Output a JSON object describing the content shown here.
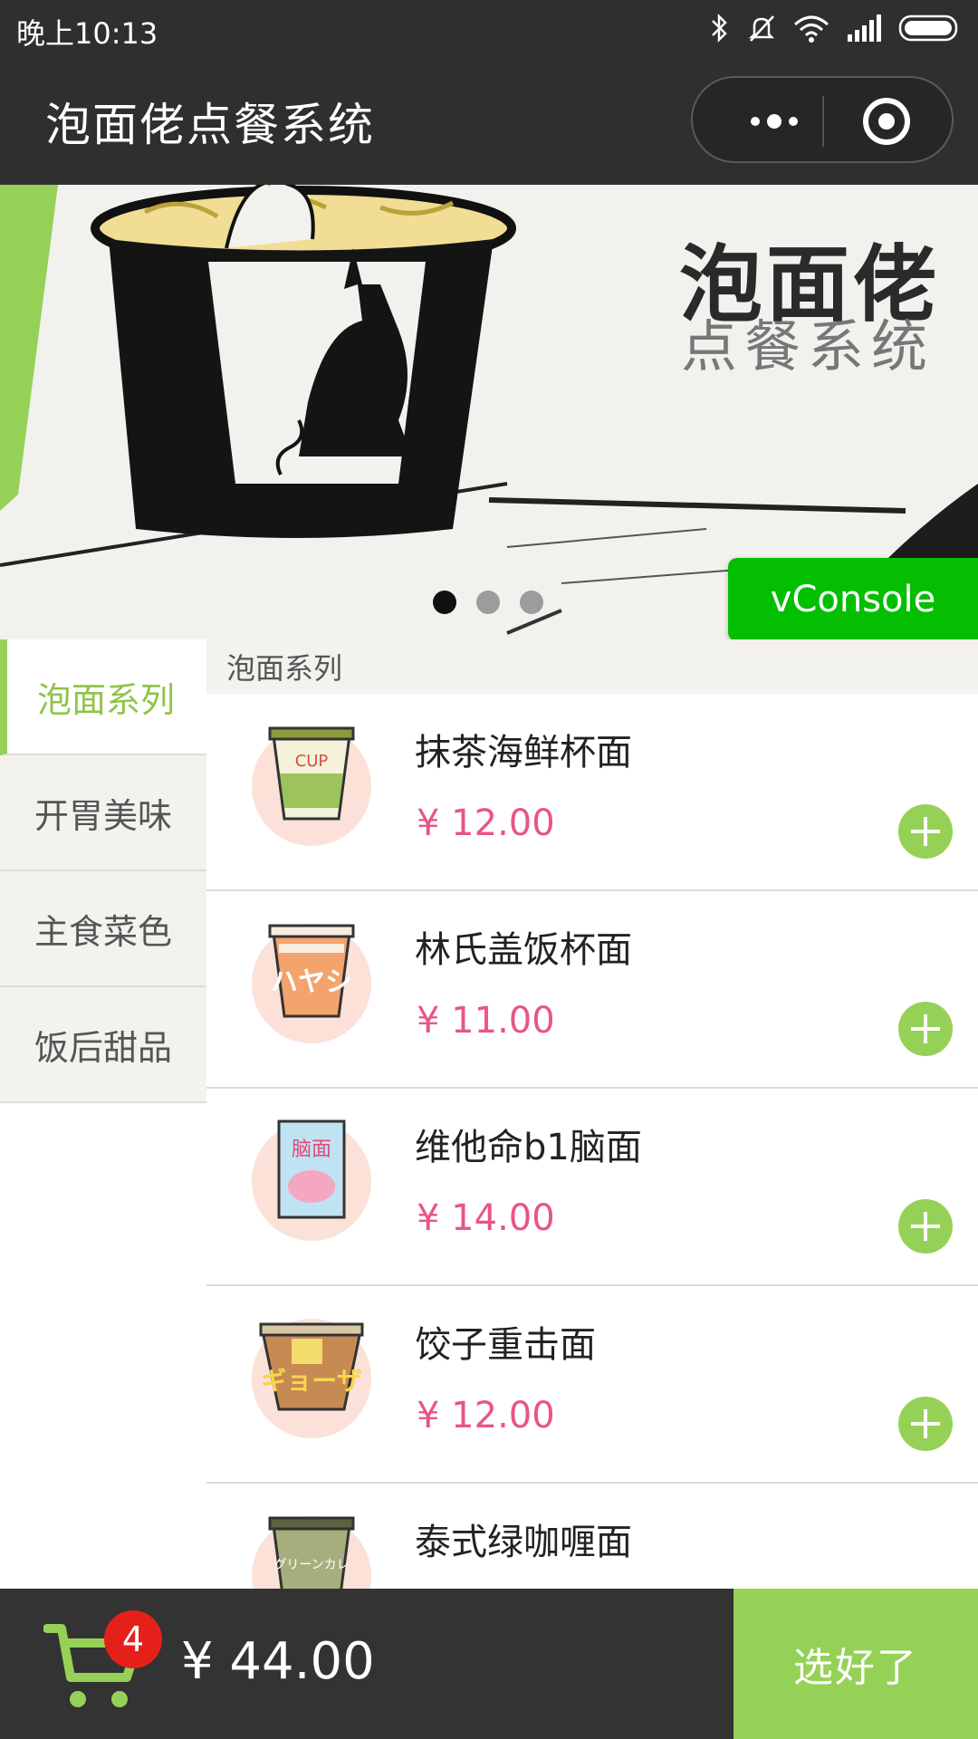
{
  "status_bar": {
    "time": "晚上10:13"
  },
  "app": {
    "title": "泡面佬点餐系统"
  },
  "banner": {
    "brand_title": "泡面佬",
    "brand_subtitle": "点餐系统",
    "slide_count": 3,
    "active_slide": 0
  },
  "vconsole_label": "vConsole",
  "categories": [
    {
      "label": "泡面系列",
      "active": true
    },
    {
      "label": "开胃美味",
      "active": false
    },
    {
      "label": "主食菜色",
      "active": false
    },
    {
      "label": "饭后甜品",
      "active": false
    }
  ],
  "section": {
    "title": "泡面系列"
  },
  "items": [
    {
      "name": "抹茶海鲜杯面",
      "price": "¥ 12.00",
      "icon": "matcha-cup-noodle-icon"
    },
    {
      "name": "林氏盖饭杯面",
      "price": "¥ 11.00",
      "icon": "hayashi-cup-noodle-icon"
    },
    {
      "name": "维他命b1脑面",
      "price": "¥ 14.00",
      "icon": "brain-noodle-bag-icon"
    },
    {
      "name": "饺子重击面",
      "price": "¥ 12.00",
      "icon": "dumpling-bowl-noodle-icon"
    },
    {
      "name": "泰式绿咖喱面",
      "price": "",
      "icon": "green-curry-cup-noodle-icon"
    }
  ],
  "cart": {
    "count": "4",
    "total": "¥ 44.00"
  },
  "checkout_label": "选好了",
  "colors": {
    "accent_green": "#96d157",
    "price_pink": "#e8548a",
    "header_dark": "#2f2f2f",
    "badge_red": "#e5201b",
    "vconsole_green": "#04be02"
  }
}
